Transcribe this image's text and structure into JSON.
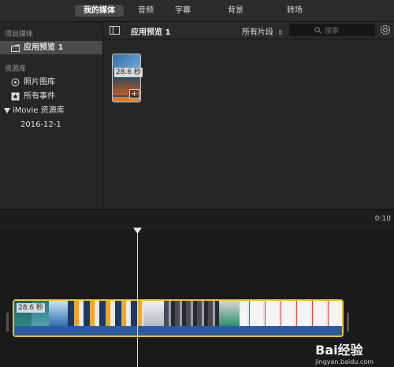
{
  "tabs": [
    {
      "label": "我的媒体",
      "active": true
    },
    {
      "label": "音频",
      "active": false
    },
    {
      "label": "字幕",
      "active": false
    },
    {
      "label": "背景",
      "active": false
    },
    {
      "label": "转场",
      "active": false
    }
  ],
  "sidebar": {
    "project_media_label": "项目媒体",
    "project_item": "应用预览 1",
    "library_label": "资源库",
    "items": [
      {
        "label": "照片图库",
        "icon": "flower-icon"
      },
      {
        "label": "所有事件",
        "icon": "star-icon"
      }
    ],
    "library_name": "iMovie 资源库",
    "event_date": "2016-12-1"
  },
  "browser": {
    "title": "应用预览 1",
    "filter": "所有片段",
    "search_placeholder": "搜索",
    "clip_duration": "28.6 秒"
  },
  "timeline": {
    "time_marker": "0:10",
    "clip_duration": "28.6 秒"
  },
  "watermark": {
    "text": "Bai经验",
    "sub": "jingyan.baidu.com"
  },
  "colors": {
    "selection": "#f0c419",
    "audio": "#2c5aa6",
    "accent_orange": "#e07a1f"
  }
}
